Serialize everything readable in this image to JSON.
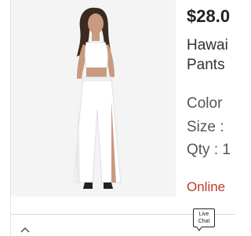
{
  "product": {
    "price": "$28.0",
    "title_line_1": "Hawai",
    "title_line_2": "Pants",
    "image_alt": "model-wearing-white-crop-top-and-slit-pants"
  },
  "options": {
    "color_label": "Color",
    "size_label": "Size :",
    "qty_label": "Qty : 1"
  },
  "availability": {
    "text": "Online",
    "color": "#c0392b"
  },
  "footer": {
    "live_chat_line_1": "Live",
    "live_chat_line_2": "Chat",
    "collapse_icon": "chevron-up-icon"
  }
}
